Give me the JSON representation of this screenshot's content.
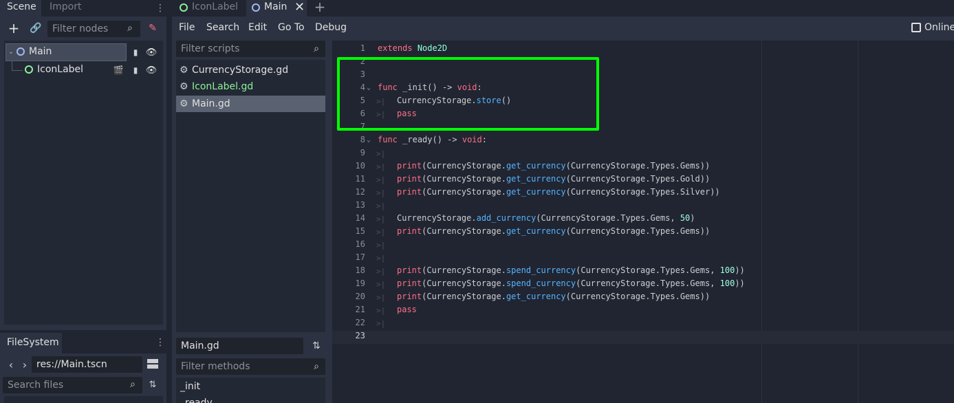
{
  "left_dock": {
    "tabs": [
      "Scene",
      "Import"
    ],
    "filter_placeholder": "Filter nodes",
    "tree": [
      {
        "label": "Main"
      },
      {
        "label": "IconLabel"
      }
    ]
  },
  "filesystem": {
    "tab": "FileSystem",
    "path": "res://Main.tscn",
    "search_placeholder": "Search files"
  },
  "editor_tabs": [
    "IconLabel",
    "Main"
  ],
  "menu": [
    "File",
    "Search",
    "Edit",
    "Go To",
    "Debug"
  ],
  "online_docs": "Online",
  "scripts": {
    "filter_placeholder": "Filter scripts",
    "items": [
      "CurrencyStorage.gd",
      "IconLabel.gd",
      "Main.gd"
    ],
    "current": "Main.gd",
    "methods_placeholder": "Filter methods",
    "methods": [
      "_init",
      "_ready"
    ]
  },
  "code_lines": [
    "1",
    "2",
    "3",
    "4",
    "5",
    "6",
    "7",
    "8",
    "9",
    "10",
    "11",
    "12",
    "13",
    "14",
    "15",
    "16",
    "17",
    "18",
    "19",
    "20",
    "21",
    "22",
    "23"
  ],
  "code": {
    "l1a": "extends",
    "l1b": "Node2D",
    "l4a": "func",
    "l4b": "_init() -> ",
    "l4c": "void",
    "l4d": ":",
    "l5a": "CurrencyStorage.",
    "l5b": "store",
    "l5c": "()",
    "l6": "pass",
    "l8a": "func",
    "l8b": "_ready() -> ",
    "l8c": "void",
    "l8d": ":",
    "print": "print",
    "cs": "CurrencyStorage.",
    "get": "get_currency",
    "add": "add_currency",
    "spend": "spend_currency",
    "gems": "CurrencyStorage.Types.Gems",
    "gold": "CurrencyStorage.Types.Gold",
    "silver": "CurrencyStorage.Types.Silver",
    "n50": "50",
    "n100": "100",
    "pass": "pass"
  },
  "colors": {
    "highlight_box": "#00ff00",
    "keyword": "#ff7085",
    "type": "#8effda",
    "function": "#57b3ff"
  }
}
